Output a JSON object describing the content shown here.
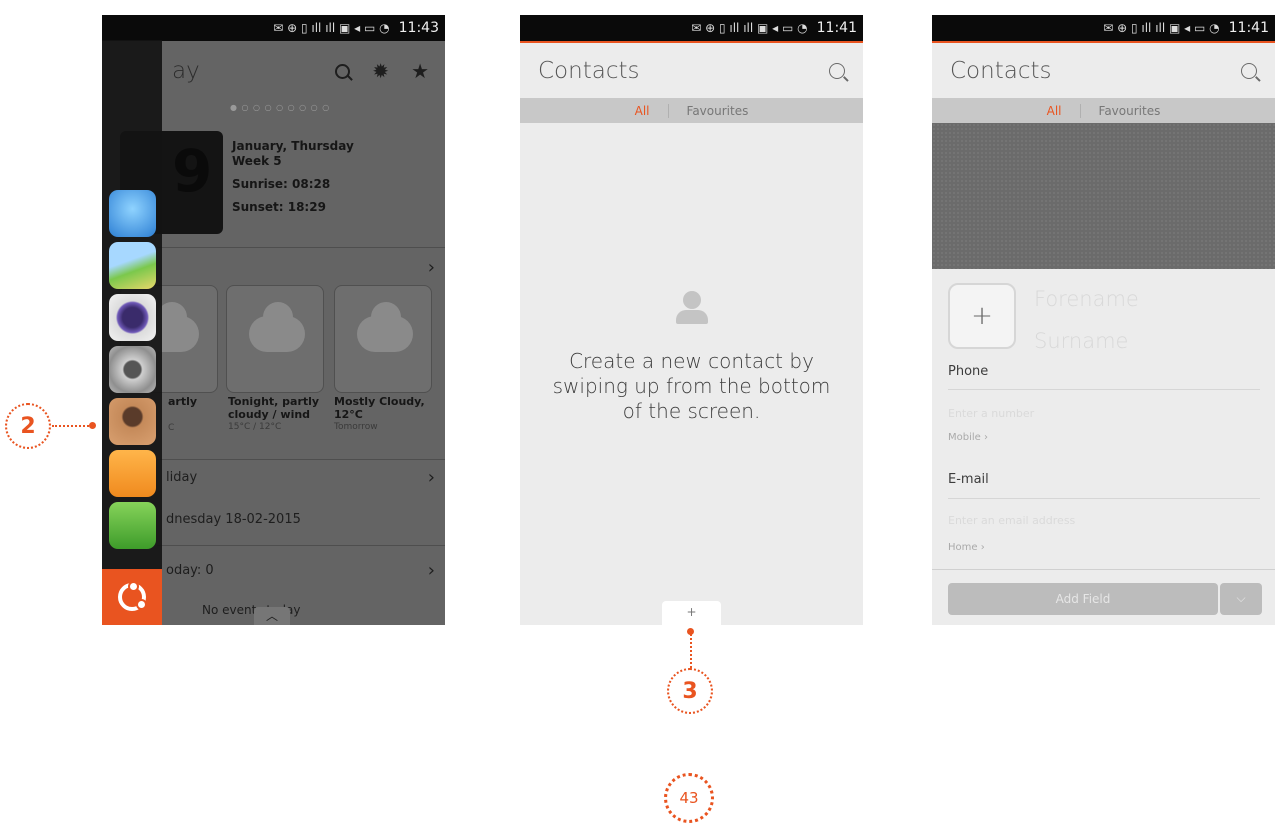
{
  "status_bar": {
    "time_1": "11:43",
    "time_2": "11:41",
    "time_3": "11:41",
    "glyphs": "✉ ⊕ ▯ ıll ıll ▣ ◂ ▭ ◔"
  },
  "screen_today": {
    "title": "ay",
    "page_dots": "● ○ ○ ○ ○ ○ ○ ○ ○",
    "clock_digit": "9",
    "date_line1": "January, Thursday",
    "date_line2": "Week 5",
    "sunrise": "Sunrise: 08:28",
    "sunset": "Sunset: 18:29",
    "weather": [
      {
        "title_1": "artly",
        "title_2": "",
        "sub": "C"
      },
      {
        "title_1": "Tonight, partly",
        "title_2": "cloudy / wind",
        "sub": "15°C / 12°C"
      },
      {
        "title_1": "Mostly Cloudy,",
        "title_2": "12°C",
        "sub": "Tomorrow"
      }
    ],
    "holiday_row": "liday",
    "holiday_date": "dnesday 18-02-2015",
    "today_row": "oday: 0",
    "no_events": "No events today",
    "chevron": "›",
    "handle_glyph": "︿",
    "launcher_icons": [
      "browser-icon",
      "maps-icon",
      "camera-icon",
      "media-player-icon",
      "contacts-icon",
      "messaging-icon",
      "dialer-icon"
    ]
  },
  "screen_contacts_empty": {
    "title": "Contacts",
    "tab_all": "All",
    "tab_favourites": "Favourites",
    "empty_message": "Create a new contact by swiping up from the bottom of the screen.",
    "bottom_edge_label": "+"
  },
  "screen_contact_new": {
    "title": "Contacts",
    "tab_all": "All",
    "tab_favourites": "Favourites",
    "add_photo": "+",
    "forename_placeholder": "Forename",
    "surname_placeholder": "Surname",
    "phone_label": "Phone",
    "phone_placeholder": "Enter a number",
    "phone_type": "Mobile ›",
    "email_label": "E-mail",
    "email_placeholder": "Enter an email address",
    "email_type": "Home ›",
    "add_field_label": "Add Field",
    "dropdown_glyph": "⌵"
  },
  "callouts": {
    "c2": "2",
    "c3": "3"
  },
  "page_number": "43",
  "colors": {
    "accent": "#e95420",
    "launcher": "#141414",
    "tab_bar": "#c8c8c8"
  }
}
